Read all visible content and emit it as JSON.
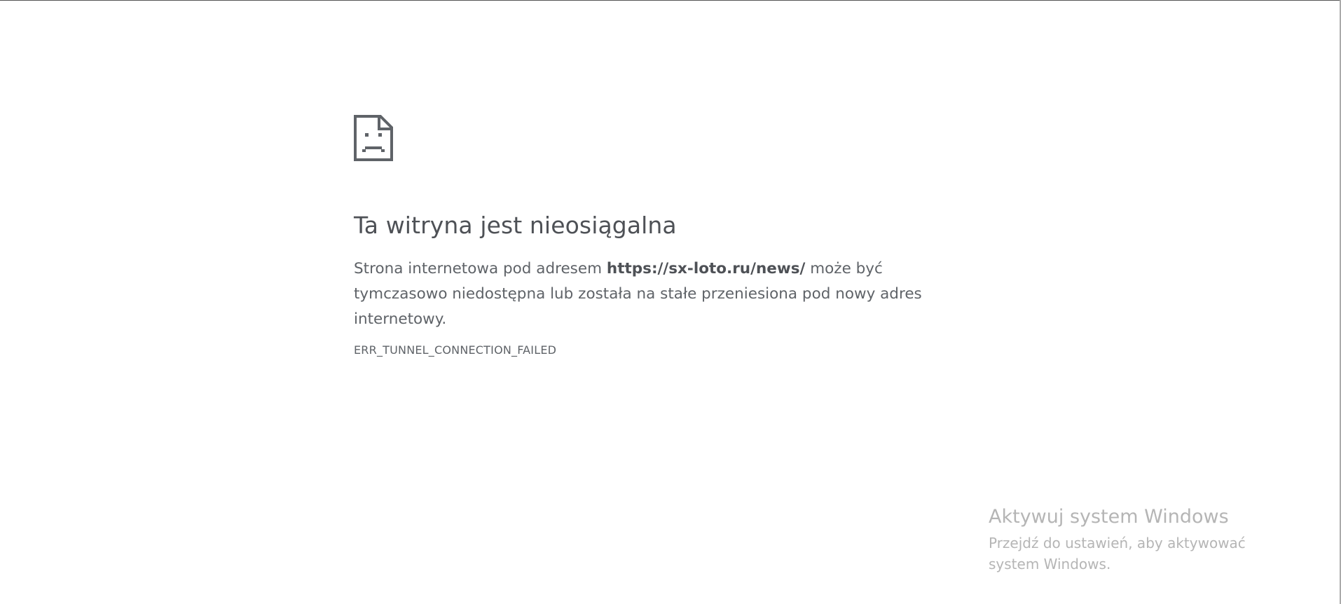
{
  "error_page": {
    "icon": "sad-document-icon",
    "title": "Ta witryna jest nieosiągalna",
    "description_before": "Strona internetowa pod adresem ",
    "url": "https://sx-loto.ru/news/",
    "description_after": " może być tymczasowo niedostępna lub została na stałe przeniesiona pod nowy adres internetowy.",
    "error_code": "ERR_TUNNEL_CONNECTION_FAILED"
  },
  "watermark": {
    "title": "Aktywuj system Windows",
    "subtitle": "Przejdź do ustawień, aby aktywować system Windows."
  },
  "colors": {
    "text": "#5f6368",
    "heading": "#4e5156",
    "watermark": "#b5b5b5",
    "background": "#ffffff"
  }
}
